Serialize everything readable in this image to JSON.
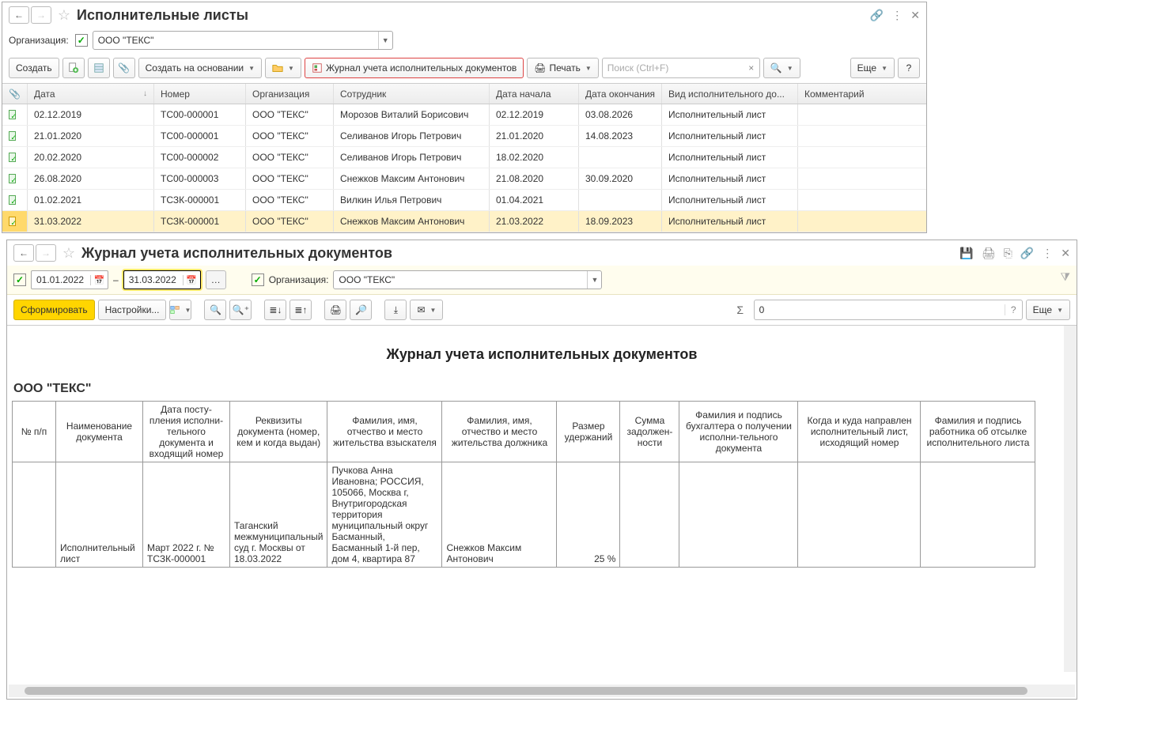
{
  "top": {
    "title": "Исполнительные листы",
    "org_label": "Организация:",
    "org_value": "ООО \"ТЕКС\"",
    "toolbar": {
      "create": "Создать",
      "create_based": "Создать на основании",
      "journal": "Журнал учета исполнительных документов",
      "print": "Печать",
      "search_placeholder": "Поиск (Ctrl+F)",
      "more": "Еще",
      "help": "?"
    },
    "columns": {
      "attach": "",
      "date": "Дата",
      "number": "Номер",
      "org": "Организация",
      "employee": "Сотрудник",
      "start": "Дата начала",
      "end": "Дата окончания",
      "type": "Вид исполнительного до...",
      "comment": "Комментарий"
    },
    "rows": [
      {
        "date": "02.12.2019",
        "num": "ТС00-000001",
        "org": "ООО \"ТЕКС\"",
        "emp": "Морозов Виталий Борисович",
        "start": "02.12.2019",
        "end": "03.08.2026",
        "type": "Исполнительный лист",
        "sel": false
      },
      {
        "date": "21.01.2020",
        "num": "ТС00-000001",
        "org": "ООО \"ТЕКС\"",
        "emp": "Селиванов Игорь Петрович",
        "start": "21.01.2020",
        "end": "14.08.2023",
        "type": "Исполнительный лист",
        "sel": false
      },
      {
        "date": "20.02.2020",
        "num": "ТС00-000002",
        "org": "ООО \"ТЕКС\"",
        "emp": "Селиванов Игорь Петрович",
        "start": "18.02.2020",
        "end": "",
        "type": "Исполнительный лист",
        "sel": false
      },
      {
        "date": "26.08.2020",
        "num": "ТС00-000003",
        "org": "ООО \"ТЕКС\"",
        "emp": "Снежков Максим Антонович",
        "start": "21.08.2020",
        "end": "30.09.2020",
        "type": "Исполнительный лист",
        "sel": false
      },
      {
        "date": "01.02.2021",
        "num": "ТСЗК-000001",
        "org": "ООО \"ТЕКС\"",
        "emp": "Вилкин Илья Петрович",
        "start": "01.04.2021",
        "end": "",
        "type": "Исполнительный лист",
        "sel": false
      },
      {
        "date": "31.03.2022",
        "num": "ТСЗК-000001",
        "org": "ООО \"ТЕКС\"",
        "emp": "Снежков Максим Антонович",
        "start": "21.03.2022",
        "end": "18.09.2023",
        "type": "Исполнительный лист",
        "sel": true
      }
    ]
  },
  "bottom": {
    "title": "Журнал учета исполнительных документов",
    "date_from": "01.01.2022",
    "date_to": "31.03.2022",
    "dash": "–",
    "org_label": "Организация:",
    "org_value": "ООО \"ТЕКС\"",
    "toolbar": {
      "generate": "Сформировать",
      "settings": "Настройки...",
      "more": "Еще",
      "sum_value": "0"
    },
    "report": {
      "title": "Журнал учета исполнительных документов",
      "org": "ООО \"ТЕКС\"",
      "headers": {
        "num": "№ п/п",
        "name": "Наименование документа",
        "receipt": "Дата посту-пления исполни-тельного документа и входящий номер",
        "requisites": "Реквизиты документа (номер, кем и когда выдан)",
        "recoverer": "Фамилия, имя, отчество и место жительства взыскателя",
        "debtor": "Фамилия, имя, отчество и место жительства должника",
        "amount": "Размер удержаний",
        "debt": "Сумма задолжен-ности",
        "accountant": "Фамилия и подпись бухгалтера о получении исполни-тельного документа",
        "sent": "Когда и куда направлен исполнительный лист, исходящий номер",
        "worker": "Фамилия и подпись работника об отсылке исполнительного листа"
      },
      "row": {
        "num": "",
        "name": "Исполнительный лист",
        "receipt": "Март 2022 г. № ТСЗК-000001",
        "requisites": "Таганский межмуниципальный суд г. Москвы от 18.03.2022",
        "recoverer": "Пучкова Анна Ивановна; РОССИЯ, 105066, Москва г, Внутригородская территория муниципальный округ Басманный, Басманный 1-й пер, дом 4, квартира 87",
        "debtor": "Снежков Максим Антонович",
        "amount": "25  %",
        "debt": "",
        "accountant": "",
        "sent": "",
        "worker": ""
      }
    }
  }
}
